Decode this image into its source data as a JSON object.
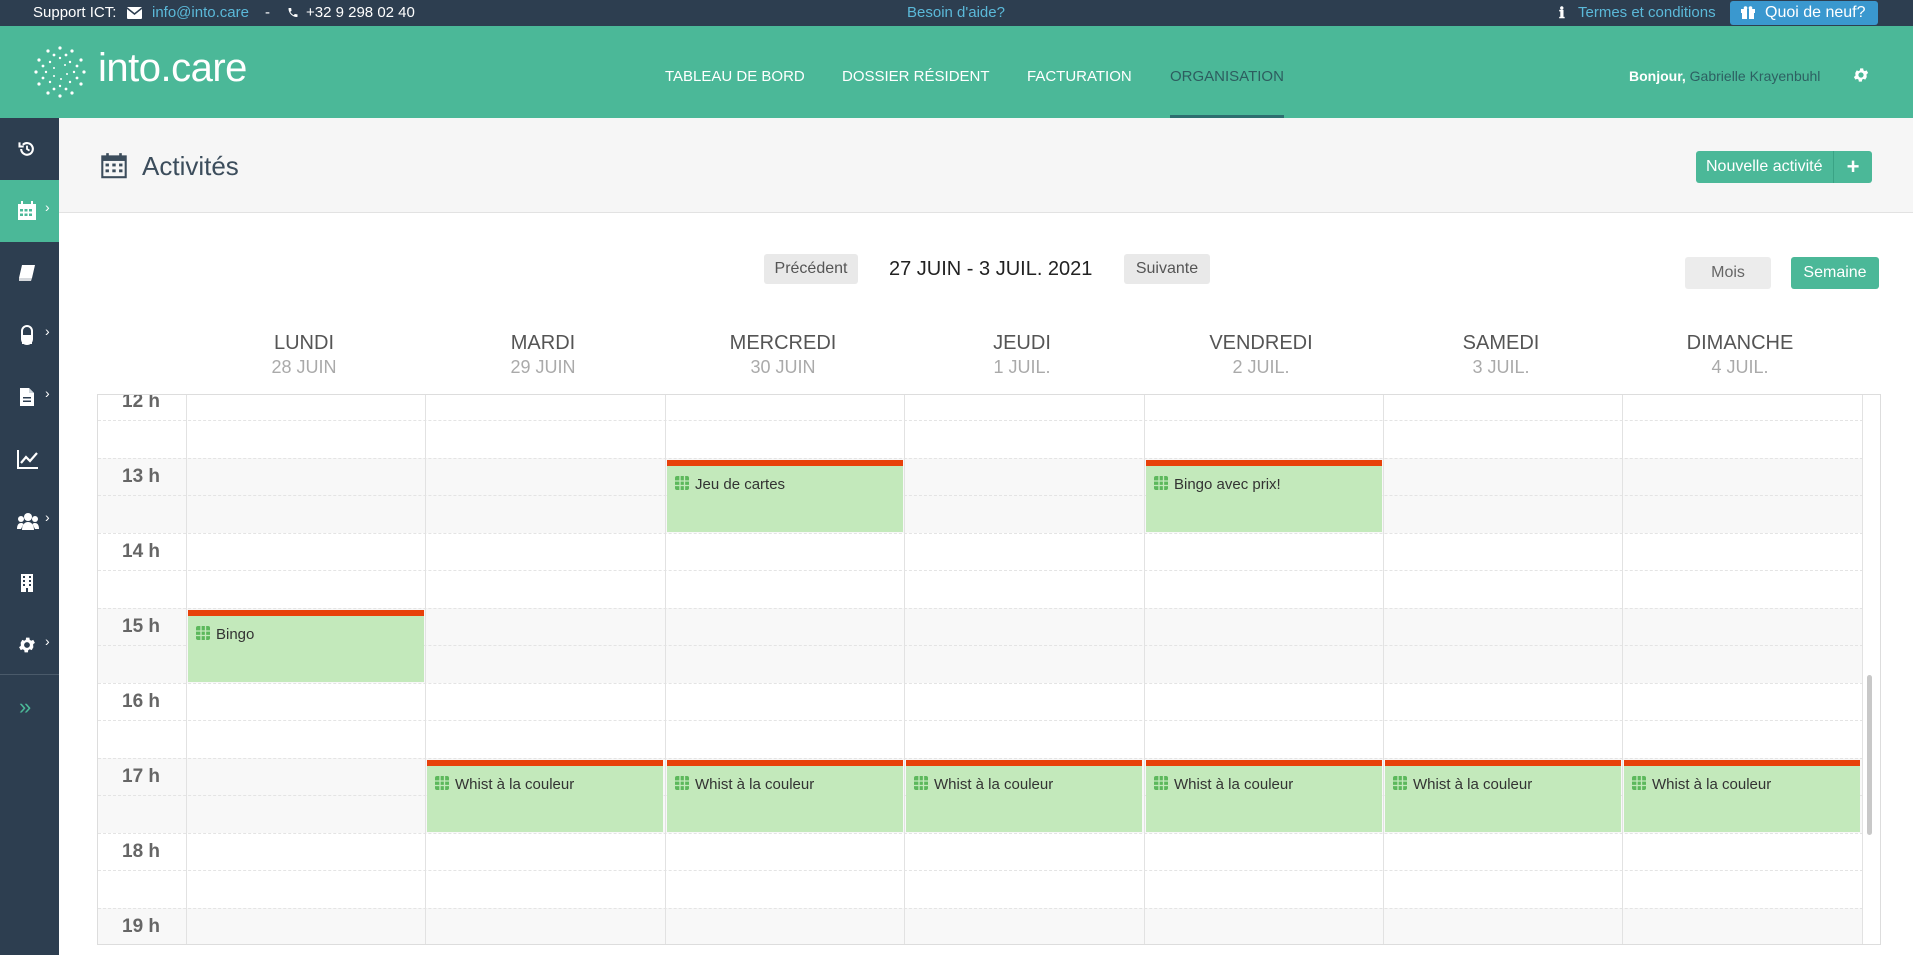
{
  "topbar": {
    "support_label": "Support ICT:",
    "email": "info@into.care",
    "separator": "-",
    "phone": "+32 9 298 02 40",
    "help": "Besoin d'aide?",
    "terms": "Termes et conditions",
    "whats_new": "Quoi de neuf?"
  },
  "header": {
    "logo_text": "into.care",
    "nav": [
      "TABLEAU DE BORD",
      "DOSSIER RÉSIDENT",
      "FACTURATION",
      "ORGANISATION"
    ],
    "active_nav": "ORGANISATION",
    "greeting_prefix": "Bonjour,",
    "user_name": "Gabrielle Krayenbuhl"
  },
  "sidebar": {
    "items": [
      {
        "icon": "history-icon",
        "has_submenu": false
      },
      {
        "icon": "calendar-icon",
        "has_submenu": true,
        "active": true
      },
      {
        "icon": "book-icon",
        "has_submenu": false
      },
      {
        "icon": "pill-icon",
        "has_submenu": true
      },
      {
        "icon": "file-icon",
        "has_submenu": true
      },
      {
        "icon": "chart-line-icon",
        "has_submenu": false
      },
      {
        "icon": "users-icon",
        "has_submenu": true
      },
      {
        "icon": "building-icon",
        "has_submenu": false
      },
      {
        "icon": "gear-icon",
        "has_submenu": true
      }
    ],
    "expand_icon": "double-chevron-right-icon"
  },
  "page": {
    "title": "Activités",
    "new_button": "Nouvelle activité"
  },
  "calendar": {
    "prev": "Précédent",
    "range": "27 JUIN - 3 JUIL. 2021",
    "next": "Suivante",
    "view_month": "Mois",
    "view_week": "Semaine",
    "active_view": "Semaine",
    "days": [
      {
        "name": "LUNDI",
        "date": "28 JUIN"
      },
      {
        "name": "MARDI",
        "date": "29 JUIN"
      },
      {
        "name": "MERCREDI",
        "date": "30 JUIN"
      },
      {
        "name": "JEUDI",
        "date": "1 JUIL."
      },
      {
        "name": "VENDREDI",
        "date": "2 JUIL."
      },
      {
        "name": "SAMEDI",
        "date": "3 JUIL."
      },
      {
        "name": "DIMANCHE",
        "date": "4 JUIL."
      }
    ],
    "hours": [
      "12 h",
      "13 h",
      "14 h",
      "15 h",
      "16 h",
      "17 h",
      "18 h",
      "19 h"
    ],
    "events": [
      {
        "title": "Jeu de cartes",
        "day": "MERCREDI",
        "start": "13:00",
        "end": "14:00"
      },
      {
        "title": "Bingo avec prix!",
        "day": "VENDREDI",
        "start": "13:00",
        "end": "14:00"
      },
      {
        "title": "Bingo",
        "day": "LUNDI",
        "start": "15:00",
        "end": "16:00"
      },
      {
        "title": "Whist à la couleur",
        "day": "MARDI",
        "start": "17:00",
        "end": "18:00"
      },
      {
        "title": "Whist à la couleur",
        "day": "MERCREDI",
        "start": "17:00",
        "end": "18:00"
      },
      {
        "title": "Whist à la couleur",
        "day": "JEUDI",
        "start": "17:00",
        "end": "18:00"
      },
      {
        "title": "Whist à la couleur",
        "day": "VENDREDI",
        "start": "17:00",
        "end": "18:00"
      },
      {
        "title": "Whist à la couleur",
        "day": "SAMEDI",
        "start": "17:00",
        "end": "18:00"
      },
      {
        "title": "Whist à la couleur",
        "day": "DIMANCHE",
        "start": "17:00",
        "end": "18:00"
      }
    ]
  },
  "colors": {
    "brand_green": "#4bb898",
    "navy": "#2d3e50",
    "event_bg": "#c3e9bb",
    "event_bar": "#e8410a",
    "link_blue": "#5bb9d9"
  }
}
